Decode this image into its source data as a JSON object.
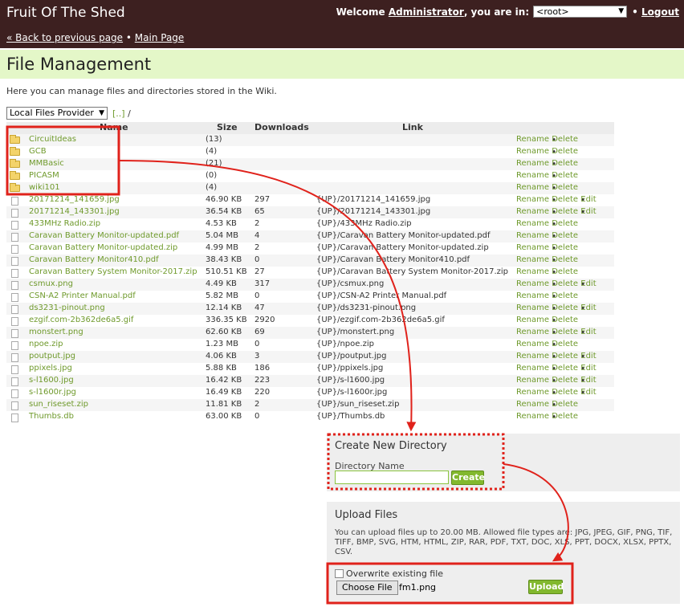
{
  "header": {
    "site_title": "Fruit Of The Shed",
    "welcome_prefix": "Welcome",
    "username": "Administrator",
    "location_prefix": ", you are in:",
    "namespace": "<root>",
    "logout_label": "Logout",
    "back_link": "« Back to previous page",
    "bullet": "•",
    "main_page_link": "Main Page"
  },
  "page": {
    "title": "File Management",
    "intro": "Here you can manage files and directories stored in the Wiki.",
    "provider": "Local Files Provider",
    "path_up": "[..]",
    "path_sep": "/"
  },
  "table": {
    "headers": {
      "name": "Name",
      "size": "Size",
      "downloads": "Downloads",
      "link": "Link"
    },
    "dot": "•",
    "rename": "Rename",
    "delete": "Delete",
    "edit": "Edit",
    "rows": [
      {
        "type": "folder",
        "name": "CircuitIdeas",
        "size": "(13)",
        "downloads": "",
        "link": "",
        "edit": false
      },
      {
        "type": "folder",
        "name": "GCB",
        "size": "(4)",
        "downloads": "",
        "link": "",
        "edit": false
      },
      {
        "type": "folder",
        "name": "MMBasic",
        "size": "(21)",
        "downloads": "",
        "link": "",
        "edit": false
      },
      {
        "type": "folder",
        "name": "PICASM",
        "size": "(0)",
        "downloads": "",
        "link": "",
        "edit": false
      },
      {
        "type": "folder",
        "name": "wiki101",
        "size": "(4)",
        "downloads": "",
        "link": "",
        "edit": false
      },
      {
        "type": "file",
        "name": "20171214_141659.jpg",
        "size": "46.90 KB",
        "downloads": "297",
        "link": "{UP}/20171214_141659.jpg",
        "edit": true
      },
      {
        "type": "file",
        "name": "20171214_143301.jpg",
        "size": "36.54 KB",
        "downloads": "65",
        "link": "{UP}/20171214_143301.jpg",
        "edit": true
      },
      {
        "type": "file",
        "name": "433MHz Radio.zip",
        "size": "4.53 KB",
        "downloads": "2",
        "link": "{UP}/433MHz Radio.zip",
        "edit": false
      },
      {
        "type": "file",
        "name": "Caravan Battery Monitor-updated.pdf",
        "size": "5.04 MB",
        "downloads": "4",
        "link": "{UP}/Caravan Battery Monitor-updated.pdf",
        "edit": false
      },
      {
        "type": "file",
        "name": "Caravan Battery Monitor-updated.zip",
        "size": "4.99 MB",
        "downloads": "2",
        "link": "{UP}/Caravan Battery Monitor-updated.zip",
        "edit": false
      },
      {
        "type": "file",
        "name": "Caravan Battery Monitor410.pdf",
        "size": "38.43 KB",
        "downloads": "0",
        "link": "{UP}/Caravan Battery Monitor410.pdf",
        "edit": false
      },
      {
        "type": "file",
        "name": "Caravan Battery System Monitor-2017.zip",
        "size": "510.51 KB",
        "downloads": "27",
        "link": "{UP}/Caravan Battery System Monitor-2017.zip",
        "edit": false
      },
      {
        "type": "file",
        "name": "csmux.png",
        "size": "4.49 KB",
        "downloads": "317",
        "link": "{UP}/csmux.png",
        "edit": true
      },
      {
        "type": "file",
        "name": "CSN-A2 Printer Manual.pdf",
        "size": "5.82 MB",
        "downloads": "0",
        "link": "{UP}/CSN-A2 Printer Manual.pdf",
        "edit": false
      },
      {
        "type": "file",
        "name": "ds3231-pinout.png",
        "size": "12.14 KB",
        "downloads": "47",
        "link": "{UP}/ds3231-pinout.png",
        "edit": true
      },
      {
        "type": "file",
        "name": "ezgif.com-2b362de6a5.gif",
        "size": "336.35 KB",
        "downloads": "2920",
        "link": "{UP}/ezgif.com-2b362de6a5.gif",
        "edit": false
      },
      {
        "type": "file",
        "name": "monstert.png",
        "size": "62.60 KB",
        "downloads": "69",
        "link": "{UP}/monstert.png",
        "edit": true
      },
      {
        "type": "file",
        "name": "npoe.zip",
        "size": "1.23 MB",
        "downloads": "0",
        "link": "{UP}/npoe.zip",
        "edit": false
      },
      {
        "type": "file",
        "name": "poutput.jpg",
        "size": "4.06 KB",
        "downloads": "3",
        "link": "{UP}/poutput.jpg",
        "edit": true
      },
      {
        "type": "file",
        "name": "ppixels.jpg",
        "size": "5.88 KB",
        "downloads": "186",
        "link": "{UP}/ppixels.jpg",
        "edit": true
      },
      {
        "type": "file",
        "name": "s-l1600.jpg",
        "size": "16.42 KB",
        "downloads": "223",
        "link": "{UP}/s-l1600.jpg",
        "edit": true
      },
      {
        "type": "file",
        "name": "s-l1600r.jpg",
        "size": "16.49 KB",
        "downloads": "220",
        "link": "{UP}/s-l1600r.jpg",
        "edit": true
      },
      {
        "type": "file",
        "name": "sun_riseset.zip",
        "size": "11.81 KB",
        "downloads": "2",
        "link": "{UP}/sun_riseset.zip",
        "edit": false
      },
      {
        "type": "file",
        "name": "Thumbs.db",
        "size": "63.00 KB",
        "downloads": "0",
        "link": "{UP}/Thumbs.db",
        "edit": false
      }
    ]
  },
  "create_dir": {
    "title": "Create New Directory",
    "label": "Directory Name",
    "input_value": "",
    "button": "Create"
  },
  "upload": {
    "title": "Upload Files",
    "description": "You can upload files up to 20.00 MB. Allowed file types are: JPG, JPEG, GIF, PNG, TIF, TIFF, BMP, SVG, HTM, HTML, ZIP, RAR, PDF, TXT, DOC, XLS, PPT, DOCX, XLSX, PPTX, CSV.",
    "overwrite_label": "Overwrite existing file",
    "overwrite_checked": false,
    "choose_button": "Choose File",
    "chosen_file": "fm1.png",
    "upload_button": "Upload"
  },
  "colors": {
    "header_bg": "#3d2020",
    "title_band": "#e4f7c8",
    "link_green": "#6f9a2c",
    "button_green": "#82b82e",
    "annotation_red": "#e0221b"
  }
}
